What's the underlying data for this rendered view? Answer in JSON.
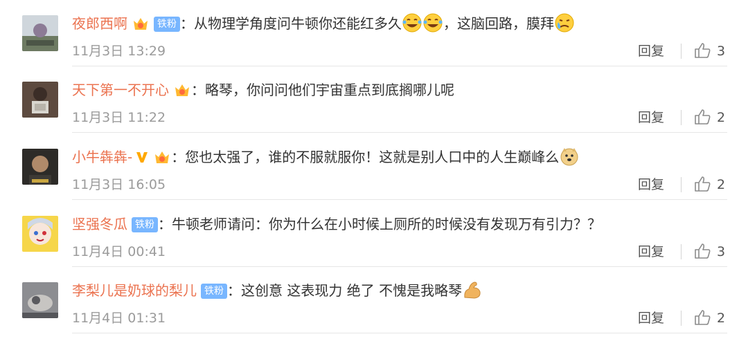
{
  "comments": [
    {
      "username": "夜郎西啊",
      "badge": "铁粉",
      "text_parts": [
        "：从物理学角度问牛顿你还能红多久",
        "，这脑回路，膜拜"
      ],
      "time": "11月3日 13:29",
      "reply_label": "回复",
      "likes": "3"
    },
    {
      "username": "天下第一不开心",
      "text_parts": [
        "：略琴，你问问他们宇宙重点到底搁哪儿呢"
      ],
      "time": "11月3日 11:22",
      "reply_label": "回复",
      "likes": "2"
    },
    {
      "username": "小牛犇犇-",
      "text_parts": [
        "：您也太强了，谁的不服就服你！这就是别人口中的人生巅峰么"
      ],
      "time": "11月3日 16:05",
      "reply_label": "回复",
      "likes": "2"
    },
    {
      "username": "坚强冬瓜",
      "badge": "铁粉",
      "text_parts": [
        "：牛顿老师请问：你为什么在小时候上厕所的时候没有发现万有引力？？"
      ],
      "time": "11月4日 00:41",
      "reply_label": "回复",
      "likes": "3"
    },
    {
      "username": "李梨儿是奶球的梨儿",
      "badge": "铁粉",
      "text_parts": [
        "：这创意 这表现力 绝了 不愧是我略琴"
      ],
      "time": "11月4日 01:31",
      "reply_label": "回复",
      "likes": "2"
    }
  ],
  "colors": {
    "username": "#eb7350",
    "badge_bg": "#78b6ff",
    "time": "#9b9b9b",
    "text": "#333333"
  }
}
